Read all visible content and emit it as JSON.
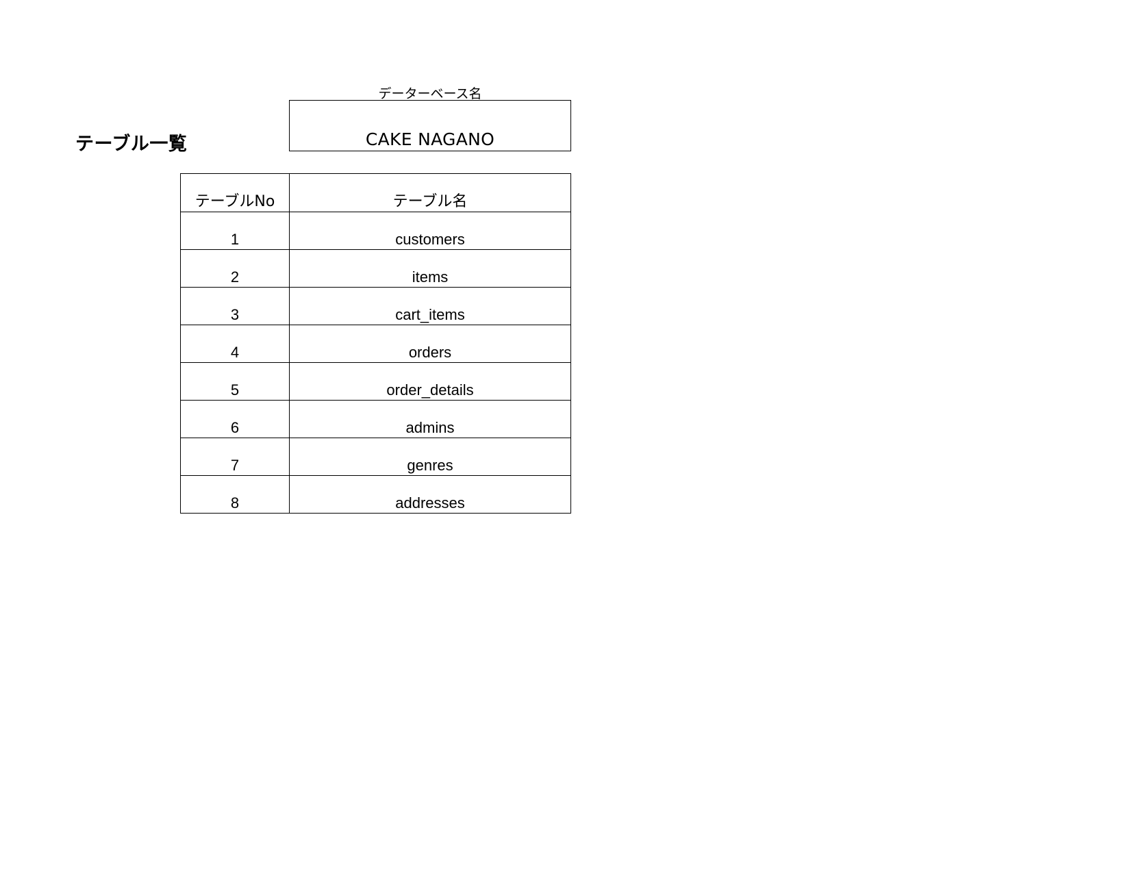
{
  "page": {
    "title": "テーブル一覧"
  },
  "database": {
    "label": "データーベース名",
    "name": "CAKE NAGANO"
  },
  "table": {
    "headers": {
      "no": "テーブルNo",
      "name": "テーブル名"
    },
    "rows": [
      {
        "no": "1",
        "name": "customers"
      },
      {
        "no": "2",
        "name": "items"
      },
      {
        "no": "3",
        "name": "cart_items"
      },
      {
        "no": "4",
        "name": "orders"
      },
      {
        "no": "5",
        "name": "order_details"
      },
      {
        "no": "6",
        "name": "admins"
      },
      {
        "no": "7",
        "name": "genres"
      },
      {
        "no": "8",
        "name": "addresses"
      }
    ]
  }
}
